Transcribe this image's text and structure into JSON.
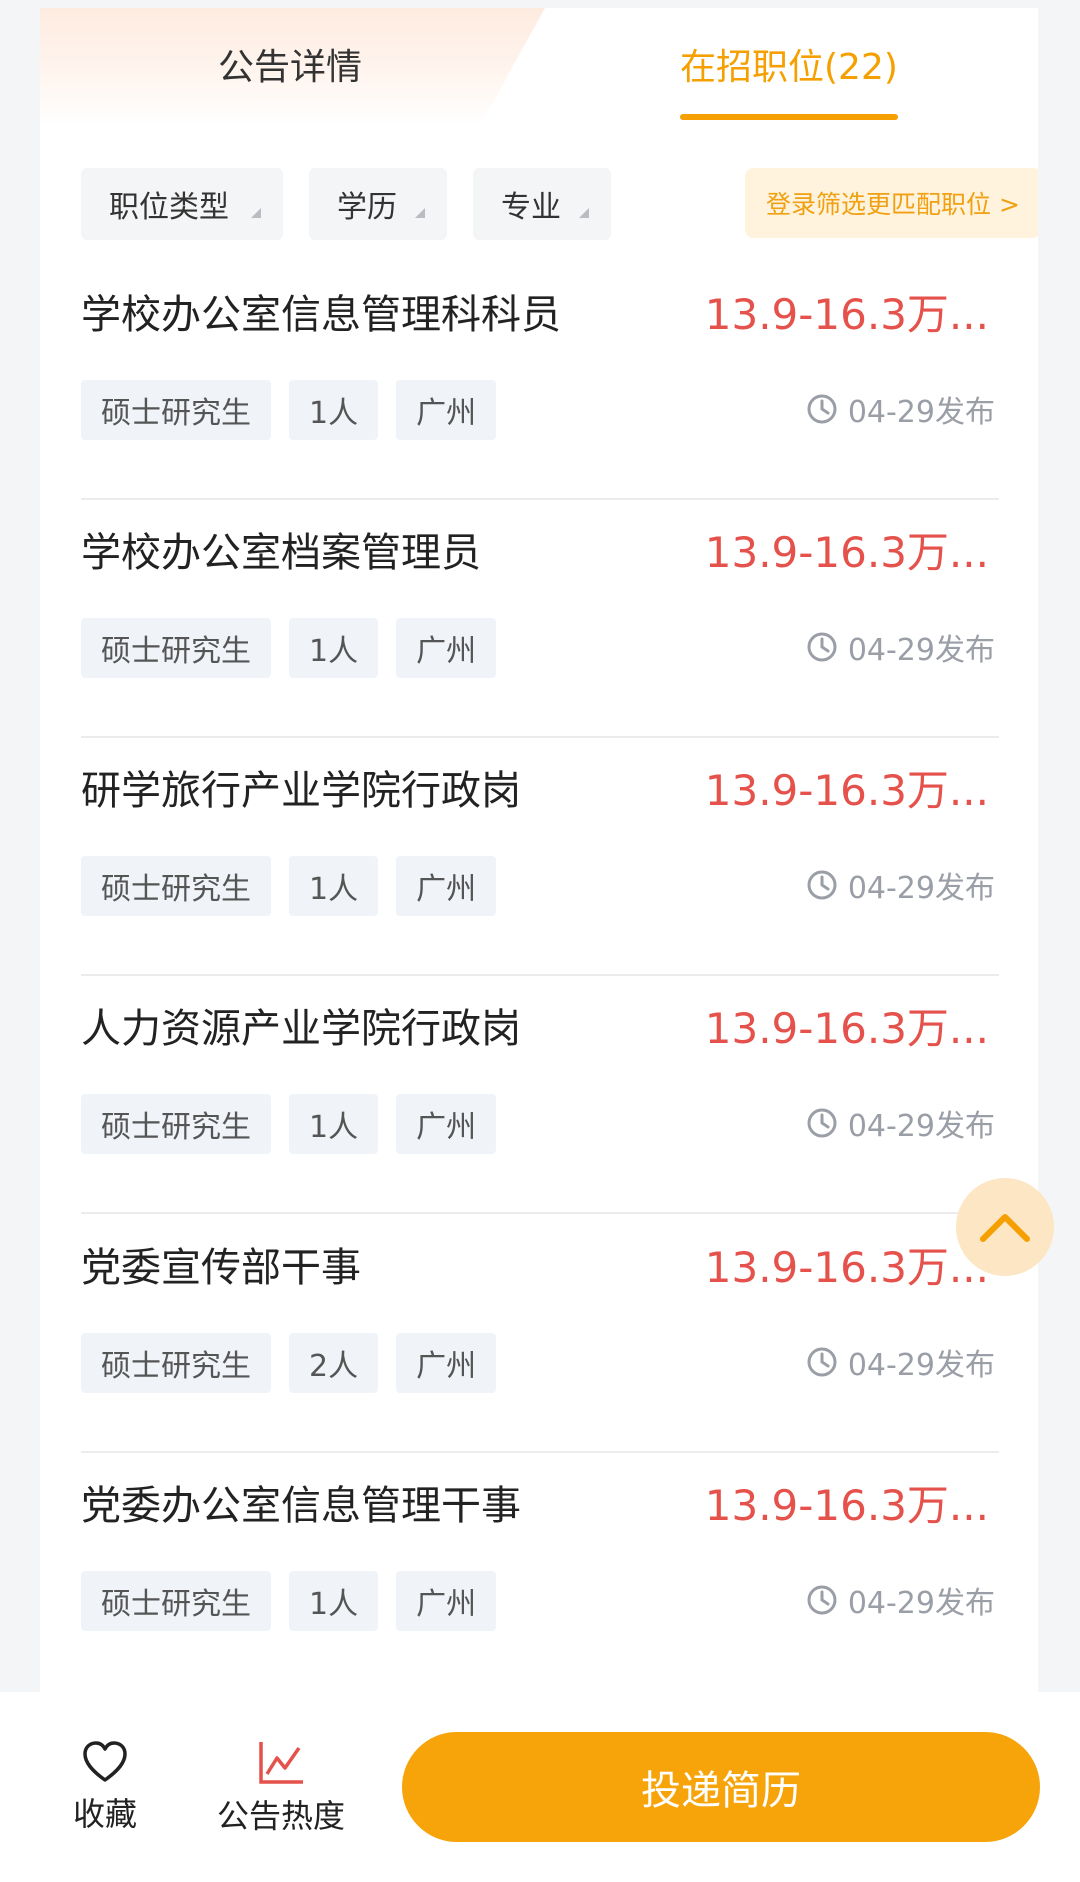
{
  "tabs": {
    "detail": "公告详情",
    "positions": "在招职位(22)"
  },
  "filters": {
    "job_type": "职位类型",
    "education": "学历",
    "major": "专业",
    "login": "登录筛选更匹配职位 >"
  },
  "jobs": [
    {
      "title": "学校办公室信息管理科科员",
      "salary": "13.9-16.3万...",
      "degree": "硕士研究生",
      "count": "1人",
      "city": "广州",
      "date": "04-29发布"
    },
    {
      "title": "学校办公室档案管理员",
      "salary": "13.9-16.3万...",
      "degree": "硕士研究生",
      "count": "1人",
      "city": "广州",
      "date": "04-29发布"
    },
    {
      "title": "研学旅行产业学院行政岗",
      "salary": "13.9-16.3万...",
      "degree": "硕士研究生",
      "count": "1人",
      "city": "广州",
      "date": "04-29发布"
    },
    {
      "title": "人力资源产业学院行政岗",
      "salary": "13.9-16.3万...",
      "degree": "硕士研究生",
      "count": "1人",
      "city": "广州",
      "date": "04-29发布"
    },
    {
      "title": "党委宣传部干事",
      "salary": "13.9-16.3万...",
      "degree": "硕士研究生",
      "count": "2人",
      "city": "广州",
      "date": "04-29发布"
    },
    {
      "title": "党委办公室信息管理干事",
      "salary": "13.9-16.3万...",
      "degree": "硕士研究生",
      "count": "1人",
      "city": "广州",
      "date": "04-29发布"
    }
  ],
  "bottom": {
    "favorite": "收藏",
    "heat": "公告热度",
    "apply": "投递简历"
  },
  "colors": {
    "accent": "#f5a000",
    "salary": "#e5514b",
    "button": "#f7a30a"
  }
}
